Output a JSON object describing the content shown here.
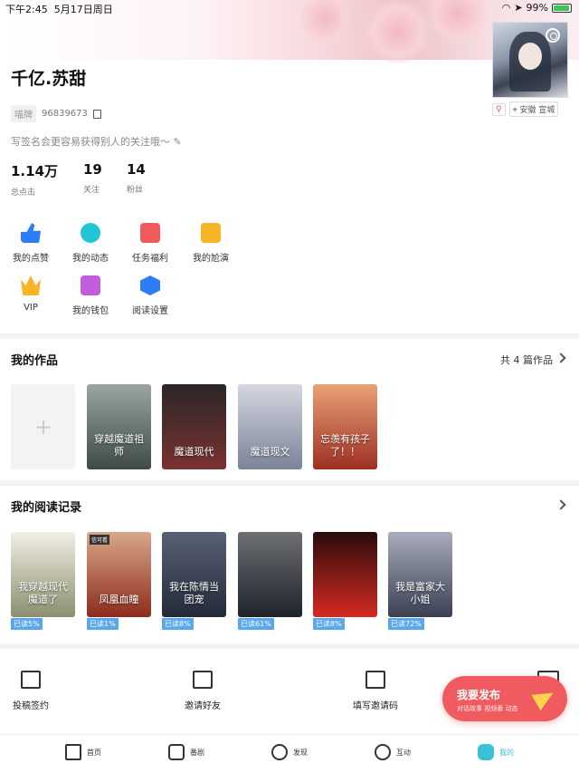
{
  "status_bar": {
    "time": "下午2:45",
    "date": "5月17日周日",
    "battery": "99%"
  },
  "profile": {
    "name": "千亿.苏甜",
    "id_tag": "喵牌",
    "id_number": "96839673",
    "gender_icon": "female-icon",
    "location": "安徽 宣城",
    "signature": "写签名会更容易获得别人的关注哦～"
  },
  "stats": [
    {
      "value": "1.14万",
      "label": "总点击"
    },
    {
      "value": "19",
      "label": "关注"
    },
    {
      "value": "14",
      "label": "粉丝"
    }
  ],
  "menu": [
    {
      "label": "我的点赞",
      "icon": "thumbs-up-icon",
      "color": "#2f7df6"
    },
    {
      "label": "我的动态",
      "icon": "compass-icon",
      "color": "#22c5d6"
    },
    {
      "label": "任务福利",
      "icon": "gift-box-icon",
      "color": "#f05a5a"
    },
    {
      "label": "我的尬演",
      "icon": "clapper-icon",
      "color": "#f7b525"
    },
    {
      "label": "VIP",
      "icon": "crown-icon",
      "color": "#f7b525"
    },
    {
      "label": "我的钱包",
      "icon": "wallet-icon",
      "color": "#c25de0"
    },
    {
      "label": "阅读设置",
      "icon": "hexagon-settings-icon",
      "color": "#2f7df6"
    }
  ],
  "works": {
    "title": "我的作品",
    "count_label": "共 4 篇作品",
    "items": [
      {
        "title": "穿越魔道祖师",
        "color": "#5b6b6b"
      },
      {
        "title": "魔道现代",
        "color": "#6b2a2a"
      },
      {
        "title": "魔道现文",
        "color": "#8b93a8"
      },
      {
        "title": "忘羡有孩子了！！",
        "color": "#c2553f"
      }
    ]
  },
  "reading": {
    "title": "我的阅读记录",
    "items": [
      {
        "title": "我穿越现代魔道了",
        "progress": "已读5%",
        "color": "#e8e4da"
      },
      {
        "title": "凤凰血瞳",
        "progress": "已读1%",
        "color": "#b0402a",
        "tag": "信可看"
      },
      {
        "title": "我在陈情当团宠",
        "progress": "已读8%",
        "color": "#3d4658"
      },
      {
        "title": "",
        "progress": "已读61%",
        "color": "#2f3640"
      },
      {
        "title": "",
        "progress": "已读8%",
        "color": "#c9211e"
      },
      {
        "title": "我是富家大小姐",
        "progress": "已读72%",
        "color": "#6d7286"
      }
    ]
  },
  "bottom_actions": [
    {
      "label": "投稿签约",
      "icon": "bookmark-icon"
    },
    {
      "label": "邀请好友",
      "icon": "envelope-icon"
    },
    {
      "label": "填写邀请码",
      "icon": "ticket-icon"
    }
  ],
  "fab": {
    "title": "我要发布",
    "subtitle": "对话故事 视频番 动态",
    "icon": "paper-plane-icon"
  },
  "tabs": [
    {
      "label": "首页",
      "icon": "home-icon"
    },
    {
      "label": "番剧",
      "icon": "play-icon"
    },
    {
      "label": "发现",
      "icon": "search-icon"
    },
    {
      "label": "互动",
      "icon": "chat-bubble-icon"
    },
    {
      "label": "我的",
      "icon": "cat-face-icon",
      "active": true
    }
  ]
}
